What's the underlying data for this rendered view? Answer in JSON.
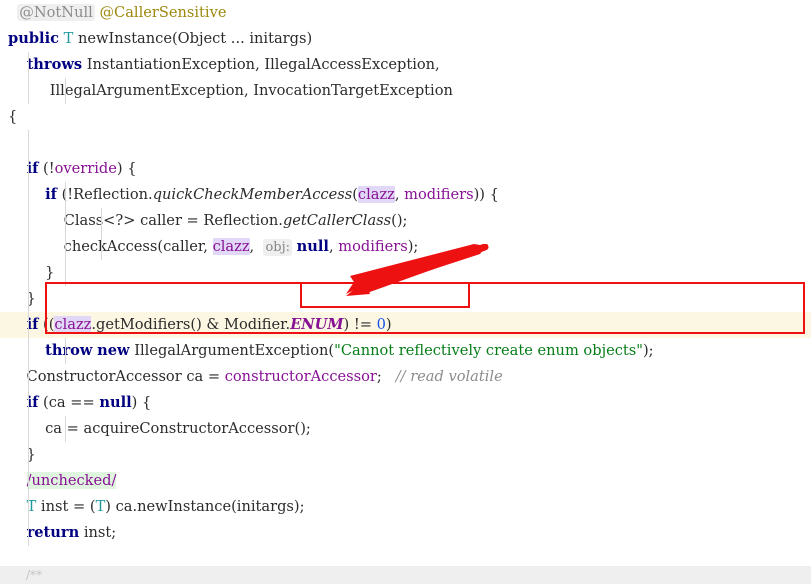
{
  "editor": {
    "language": "java",
    "colors": {
      "background": "#ffffff",
      "caret_line": "#fcf7e3",
      "keyword": "#000080",
      "type": "#20999d",
      "field": "#871094",
      "string": "#067d17",
      "number": "#1750eb",
      "comment": "#8c8c8c",
      "annotation": "#9e880d",
      "identifier_highlight": "#e1d8f7",
      "inlay_hint_bg": "#efefef",
      "green_highlight": "#e0f5e0",
      "annotation_red": "#ee1111"
    }
  },
  "code": {
    "lines": [
      {
        "id": "line-annotation",
        "indent": 0,
        "guides": [],
        "tokens": [
          {
            "t": "  ",
            "c": "plain"
          },
          {
            "t": "@NotNull",
            "c": "inlay-anno"
          },
          {
            "t": " ",
            "c": "plain"
          },
          {
            "t": "@CallerSensitive",
            "c": "anno"
          }
        ]
      },
      {
        "id": "line-signature",
        "indent": 0,
        "guides": [],
        "tokens": [
          {
            "t": "public",
            "c": "kw"
          },
          {
            "t": " ",
            "c": "plain"
          },
          {
            "t": "T",
            "c": "typ"
          },
          {
            "t": " newInstance(Object ... initargs)",
            "c": "plain"
          }
        ]
      },
      {
        "id": "line-throws-1",
        "indent": 0,
        "guides": [
          "g1"
        ],
        "tokens": [
          {
            "t": "    ",
            "c": "plain"
          },
          {
            "t": "throws",
            "c": "kw"
          },
          {
            "t": " InstantiationException, IllegalAccessException,",
            "c": "plain"
          }
        ]
      },
      {
        "id": "line-throws-2",
        "indent": 0,
        "guides": [
          "g1",
          "g2"
        ],
        "tokens": [
          {
            "t": "         IllegalArgumentException, InvocationTargetException",
            "c": "plain"
          }
        ]
      },
      {
        "id": "line-open-brace",
        "indent": 0,
        "guides": [],
        "tokens": [
          {
            "t": "{",
            "c": "plain"
          }
        ]
      },
      {
        "id": "line-blank-1",
        "indent": 0,
        "guides": [
          "g1"
        ],
        "tokens": [
          {
            "t": " ",
            "c": "plain"
          }
        ]
      },
      {
        "id": "line-if-override",
        "indent": 0,
        "guides": [
          "g1"
        ],
        "tokens": [
          {
            "t": "    ",
            "c": "plain"
          },
          {
            "t": "if",
            "c": "kw"
          },
          {
            "t": " (!",
            "c": "plain"
          },
          {
            "t": "override",
            "c": "fld"
          },
          {
            "t": ") {",
            "c": "plain"
          }
        ]
      },
      {
        "id": "line-if-quickcheck",
        "indent": 0,
        "guides": [
          "g1",
          "g2"
        ],
        "tokens": [
          {
            "t": "        ",
            "c": "plain"
          },
          {
            "t": "if",
            "c": "kw"
          },
          {
            "t": " (!Reflection.",
            "c": "plain"
          },
          {
            "t": "quickCheckMemberAccess",
            "c": "mthi"
          },
          {
            "t": "(",
            "c": "plain"
          },
          {
            "t": "clazz",
            "c": "idhl-fld"
          },
          {
            "t": ", ",
            "c": "plain"
          },
          {
            "t": "modifiers",
            "c": "fld"
          },
          {
            "t": ")) {",
            "c": "plain"
          }
        ]
      },
      {
        "id": "line-caller",
        "indent": 0,
        "guides": [
          "g1",
          "g2",
          "g3"
        ],
        "tokens": [
          {
            "t": "            Class<?> caller = Reflection.",
            "c": "plain"
          },
          {
            "t": "getCallerClass",
            "c": "mthi"
          },
          {
            "t": "();",
            "c": "plain"
          }
        ]
      },
      {
        "id": "line-checkaccess",
        "indent": 0,
        "guides": [
          "g1",
          "g2",
          "g3"
        ],
        "tokens": [
          {
            "t": "            checkAccess(caller, ",
            "c": "plain"
          },
          {
            "t": "clazz",
            "c": "idhl-fld"
          },
          {
            "t": ",  ",
            "c": "plain"
          },
          {
            "t": "obj:",
            "c": "inlay"
          },
          {
            "t": " ",
            "c": "plain"
          },
          {
            "t": "null",
            "c": "kw"
          },
          {
            "t": ", ",
            "c": "plain"
          },
          {
            "t": "modifiers",
            "c": "fld"
          },
          {
            "t": ");",
            "c": "plain"
          }
        ]
      },
      {
        "id": "line-close-inner",
        "indent": 0,
        "guides": [
          "g1",
          "g2"
        ],
        "tokens": [
          {
            "t": "        }",
            "c": "plain"
          }
        ]
      },
      {
        "id": "line-close-override",
        "indent": 0,
        "guides": [
          "g1"
        ],
        "tokens": [
          {
            "t": "    }",
            "c": "plain"
          }
        ]
      },
      {
        "id": "line-if-enum",
        "indent": 0,
        "caret": true,
        "guides": [
          "g1"
        ],
        "tokens": [
          {
            "t": "    ",
            "c": "plain"
          },
          {
            "t": "if",
            "c": "kw"
          },
          {
            "t": " ((",
            "c": "plain"
          },
          {
            "t": "clazz",
            "c": "idhl-fld"
          },
          {
            "t": ".getModifiers() & Modifier.",
            "c": "plain"
          },
          {
            "t": "ENUM",
            "c": "stat"
          },
          {
            "t": ") != ",
            "c": "plain"
          },
          {
            "t": "0",
            "c": "num"
          },
          {
            "t": ")",
            "c": "plain"
          }
        ]
      },
      {
        "id": "line-throw",
        "indent": 0,
        "guides": [
          "g1",
          "g2"
        ],
        "tokens": [
          {
            "t": "        ",
            "c": "plain"
          },
          {
            "t": "throw",
            "c": "kw"
          },
          {
            "t": " ",
            "c": "plain"
          },
          {
            "t": "new",
            "c": "kw"
          },
          {
            "t": " IllegalArgumentException(",
            "c": "plain"
          },
          {
            "t": "\"Cannot reflectively create enum objects\"",
            "c": "str"
          },
          {
            "t": ");",
            "c": "plain"
          }
        ]
      },
      {
        "id": "line-ca-assign",
        "indent": 0,
        "guides": [
          "g1"
        ],
        "tokens": [
          {
            "t": "    ConstructorAccessor ca = ",
            "c": "plain"
          },
          {
            "t": "constructorAccessor",
            "c": "fld"
          },
          {
            "t": ";   ",
            "c": "plain"
          },
          {
            "t": "// read volatile",
            "c": "cmt"
          }
        ]
      },
      {
        "id": "line-if-ca-null",
        "indent": 0,
        "guides": [
          "g1"
        ],
        "tokens": [
          {
            "t": "    ",
            "c": "plain"
          },
          {
            "t": "if",
            "c": "kw"
          },
          {
            "t": " (ca == ",
            "c": "plain"
          },
          {
            "t": "null",
            "c": "kw"
          },
          {
            "t": ") {",
            "c": "plain"
          }
        ]
      },
      {
        "id": "line-acquire",
        "indent": 0,
        "guides": [
          "g1",
          "g2"
        ],
        "tokens": [
          {
            "t": "        ca = acquireConstructorAccessor();",
            "c": "plain"
          }
        ]
      },
      {
        "id": "line-close-ca",
        "indent": 0,
        "guides": [
          "g1"
        ],
        "tokens": [
          {
            "t": "    }",
            "c": "plain"
          }
        ]
      },
      {
        "id": "line-unchecked",
        "indent": 0,
        "guides": [
          "g1"
        ],
        "tokens": [
          {
            "t": "    ",
            "c": "plain"
          },
          {
            "t": "/unchecked/",
            "c": "greenhl-cmt"
          }
        ]
      },
      {
        "id": "line-inst",
        "indent": 0,
        "guides": [
          "g1"
        ],
        "tokens": [
          {
            "t": "    ",
            "c": "plain"
          },
          {
            "t": "T",
            "c": "typ"
          },
          {
            "t": " inst = (",
            "c": "plain"
          },
          {
            "t": "T",
            "c": "typ"
          },
          {
            "t": ") ca.newInstance(initargs);",
            "c": "plain"
          }
        ]
      },
      {
        "id": "line-return",
        "indent": 0,
        "guides": [
          "g1"
        ],
        "tokens": [
          {
            "t": "    ",
            "c": "plain"
          },
          {
            "t": "return",
            "c": "kw"
          },
          {
            "t": " inst;",
            "c": "plain"
          }
        ]
      },
      {
        "id": "line-close-method",
        "indent": 0,
        "guides": [],
        "tokens": [
          {
            "t": "}",
            "c": "plain"
          }
        ]
      }
    ]
  },
  "annotations": {
    "outer_box_label": "highlighted statement: if ((clazz.getModifiers() & Modifier.ENUM) != 0) throw new IllegalArgumentException(\"Cannot reflectively create enum objects\");",
    "inner_box_label": "Modifier.ENUM",
    "arrow_label": "pointer-to-Modifier.ENUM"
  },
  "bottom": {
    "next_comment": "/**"
  }
}
